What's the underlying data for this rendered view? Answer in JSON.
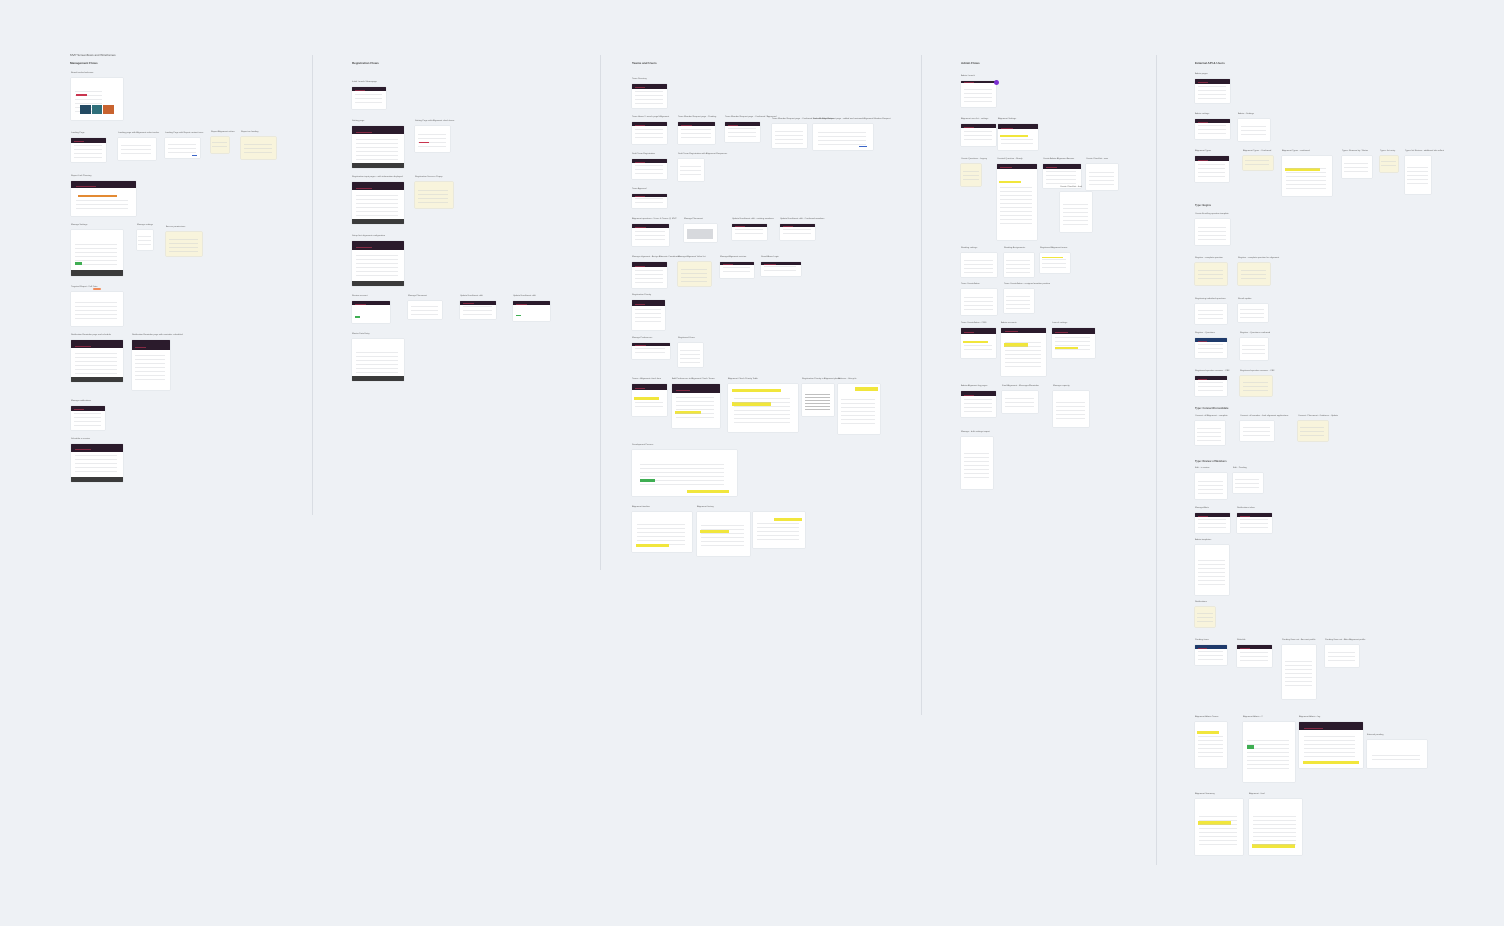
{
  "page": {
    "title": "MVP Screenflows and Wireframes"
  },
  "columns": [
    {
      "title": "Management Flows",
      "sections": [],
      "cards": [
        {
          "label": "Brand tracker/welcome",
          "style": "light",
          "variant": "tiles"
        },
        {
          "label": "Landing Page",
          "style": "light",
          "variant": "header"
        },
        {
          "label": "Landing page with Alignment value tracker",
          "style": "light",
          "variant": "lines"
        },
        {
          "label": "Landing Page with Report context trace",
          "style": "light",
          "variant": "lines"
        },
        {
          "label": "Report Alignment values",
          "style": "cream",
          "variant": "lines"
        },
        {
          "label": "Report on funding",
          "style": "cream",
          "variant": "lines"
        },
        {
          "label": "Report Link Planning",
          "style": "light",
          "variant": "header-red"
        },
        {
          "label": "Manage Settings",
          "style": "light",
          "variant": "header-footer"
        },
        {
          "label": "Manage settings",
          "style": "light",
          "variant": "lines"
        },
        {
          "label": "Access permissions",
          "style": "cream",
          "variant": "lines"
        },
        {
          "label": "Targeted Report - Full Data",
          "style": "light",
          "variant": "lines"
        },
        {
          "label": "Notification Reminder page and schedule",
          "style": "light",
          "variant": "header-footer"
        },
        {
          "label": "Notification Reminder page with reminder scheduled",
          "style": "light",
          "variant": "lines"
        },
        {
          "label": "Manage notifications",
          "style": "light",
          "variant": "header"
        },
        {
          "label": "Schedule a session",
          "style": "light",
          "variant": "header-footer"
        }
      ]
    },
    {
      "title": "Registration Flows",
      "sections": [],
      "cards": [
        {
          "label": "Initial Launch/ Homepage",
          "style": "light",
          "variant": "header"
        },
        {
          "label": "Setting page",
          "style": "light",
          "variant": "header-footer"
        },
        {
          "label": "Setting Page with Alignment check items",
          "style": "light",
          "variant": "lines"
        },
        {
          "label": "Registration input pages - with information displayed",
          "style": "light",
          "variant": "header-footer"
        },
        {
          "label": "Registration Success Popup",
          "style": "cream",
          "variant": "lines"
        },
        {
          "label": "Setup first alignment configuration",
          "style": "light",
          "variant": "header-footer"
        },
        {
          "label": "Review account",
          "style": "light",
          "variant": "header"
        },
        {
          "label": "Manage Placement",
          "style": "light",
          "variant": "lines"
        },
        {
          "label": "Update Enrollment shift",
          "style": "light",
          "variant": "header"
        },
        {
          "label": "Update Enrollment shift",
          "style": "light",
          "variant": "header"
        },
        {
          "label": "Master Data Entry",
          "style": "light",
          "variant": "header-footer"
        }
      ]
    },
    {
      "title": "Teams and Users",
      "sections": [],
      "cards": [
        {
          "label": "Team Directory",
          "style": "light",
          "variant": "header"
        },
        {
          "label": "Team Home / Launch page/ Alignment",
          "style": "light",
          "variant": "header"
        },
        {
          "label": "Team Member Request page - Pending",
          "style": "light",
          "variant": "header"
        },
        {
          "label": "Team Member Request page - Confirmed / Approved",
          "style": "light",
          "variant": "header"
        },
        {
          "label": "Team Member Request page - Confirmed and user Registration",
          "style": "light",
          "variant": "lines"
        },
        {
          "label": "Team Member Request page - added and reviewed Alignment Member Request",
          "style": "light",
          "variant": "lines"
        },
        {
          "label": "Draft Team Registration",
          "style": "light",
          "variant": "header"
        },
        {
          "label": "Draft Team Registration with Alignment Responses",
          "style": "light",
          "variant": "lines"
        },
        {
          "label": "Team Approval",
          "style": "light",
          "variant": "header"
        },
        {
          "label": "Alignment questions - Users & Teams @ MVP",
          "style": "light",
          "variant": "header"
        },
        {
          "label": "Manage Placement",
          "style": "light",
          "variant": "lines"
        },
        {
          "label": "Update Enrollment shift - existing members",
          "style": "light",
          "variant": "header"
        },
        {
          "label": "Update Enrollment shift - Confirmed members",
          "style": "light",
          "variant": "header"
        },
        {
          "label": "Manage alignment - Assign Alternate Coordinator",
          "style": "light",
          "variant": "header"
        },
        {
          "label": "Manage Alignment Value list",
          "style": "light",
          "variant": "lines"
        },
        {
          "label": "Manage Alignment revision",
          "style": "light",
          "variant": "header"
        },
        {
          "label": "Stand Alone Login",
          "style": "light",
          "variant": "header"
        },
        {
          "label": "Registration Priority",
          "style": "light",
          "variant": "lines"
        },
        {
          "label": "Manage Preferences",
          "style": "light",
          "variant": "header"
        },
        {
          "label": "Registered Users",
          "style": "light",
          "variant": "lines"
        },
        {
          "label": "Teams - Alignment check lane",
          "style": "light",
          "variant": "highlight"
        },
        {
          "label": "Add Preferences to Alignment Check Teams",
          "style": "light",
          "variant": "highlight"
        },
        {
          "label": "Alignment Check Priority Table",
          "style": "light",
          "variant": "lines"
        },
        {
          "label": "Registration Priority in Alignment phase",
          "style": "light",
          "variant": "highlight"
        },
        {
          "label": "Release - Lifecycle",
          "style": "light",
          "variant": "lines"
        },
        {
          "label": "Development Process",
          "style": "light",
          "variant": "highlight"
        },
        {
          "label": "Alignment timeline",
          "style": "light",
          "variant": "highlight"
        },
        {
          "label": "Alignment history",
          "style": "light",
          "variant": "highlight"
        }
      ]
    },
    {
      "title": "Admin Flows",
      "sections": [],
      "cards": [
        {
          "label": "Admin Launch",
          "style": "light",
          "variant": "lines"
        },
        {
          "label": "Alignment user list - settings",
          "style": "light",
          "variant": "header"
        },
        {
          "label": "Alignment Settings",
          "style": "light",
          "variant": "highlight"
        },
        {
          "label": "Create Questions - Legacy",
          "style": "cream",
          "variant": "lines"
        },
        {
          "label": "Created Question - Ready",
          "style": "light",
          "variant": "header"
        },
        {
          "label": "Create Admin Alignment Answer",
          "style": "light",
          "variant": "lines"
        },
        {
          "label": "Create Checklist - new",
          "style": "light",
          "variant": "lines"
        },
        {
          "label": "Create Checklist - final",
          "style": "light",
          "variant": "lines"
        },
        {
          "label": "Reading settings",
          "style": "light",
          "variant": "lines"
        },
        {
          "label": "Reading Assignments",
          "style": "light",
          "variant": "lines"
        },
        {
          "label": "Registered Alignment teams",
          "style": "light",
          "variant": "highlight"
        },
        {
          "label": "Team Constellation",
          "style": "light",
          "variant": "header"
        },
        {
          "label": "Team Constellation - assigned member position",
          "style": "light",
          "variant": "lines"
        },
        {
          "label": "Team Constellation - CMS",
          "style": "light",
          "variant": "lines"
        },
        {
          "label": "Admin accounts",
          "style": "light",
          "variant": "lines"
        },
        {
          "label": "Launch settings",
          "style": "light",
          "variant": "cream"
        },
        {
          "label": "Admin Alignment log pages",
          "style": "light",
          "variant": "header"
        },
        {
          "label": "Final Alignment - Messages/Reminder",
          "style": "light",
          "variant": "header-footer"
        },
        {
          "label": "Manage capacity",
          "style": "light",
          "variant": "header"
        },
        {
          "label": "Manage - bulk settings import",
          "style": "light",
          "variant": "cream"
        }
      ]
    },
    {
      "title": "External API & Users",
      "sections": [
        "Type: Begins",
        "Type: Connect/Consolidate",
        "Type: Review of Members"
      ],
      "cards": [
        {
          "label": "Admin pages",
          "style": "light",
          "variant": "header"
        },
        {
          "label": "Admin settings",
          "style": "light",
          "variant": "header"
        },
        {
          "label": "Admin - Settings",
          "style": "light",
          "variant": "lines"
        },
        {
          "label": "Alignment Types",
          "style": "light",
          "variant": "header"
        },
        {
          "label": "Alignment Types - Confirmed",
          "style": "cream",
          "variant": "lines"
        },
        {
          "label": "Alignment Types - confirmed",
          "style": "light",
          "variant": "highlight"
        },
        {
          "label": "Types: Remove by / Status",
          "style": "light",
          "variant": "lines"
        },
        {
          "label": "Types: list entry",
          "style": "cream",
          "variant": "lines"
        },
        {
          "label": "Types list Review - additional info rollout",
          "style": "light",
          "variant": "lines"
        },
        {
          "label": "Create Enrolling question template",
          "style": "light",
          "variant": "lines"
        },
        {
          "label": "Register - complete question",
          "style": "cream",
          "variant": "lines"
        },
        {
          "label": "Register - complete question for alignment",
          "style": "cream",
          "variant": "lines"
        },
        {
          "label": "Registering individual questions",
          "style": "light",
          "variant": "lines"
        },
        {
          "label": "Result update",
          "style": "light",
          "variant": "lines"
        },
        {
          "label": "Register - Questions",
          "style": "light",
          "variant": "header"
        },
        {
          "label": "Register - Questions confirmed",
          "style": "light",
          "variant": "lines"
        },
        {
          "label": "Registered question answers - CBF",
          "style": "light",
          "variant": "header"
        },
        {
          "label": "Registered question answers - CBF",
          "style": "cream",
          "variant": "lines"
        },
        {
          "label": "Connect: all Alignment - complete",
          "style": "light",
          "variant": "lines"
        },
        {
          "label": "Connect: all member - final alignment applications",
          "style": "light",
          "variant": "lines"
        },
        {
          "label": "Connect: Placement - Guidance - Update",
          "style": "cream",
          "variant": "lines"
        },
        {
          "label": "Edit - in review",
          "style": "light",
          "variant": "lines"
        },
        {
          "label": "Edit - Pending",
          "style": "light",
          "variant": "lines"
        },
        {
          "label": "Manage Alerts",
          "style": "light",
          "variant": "header"
        },
        {
          "label": "Notifications inbox",
          "style": "light",
          "variant": "header"
        },
        {
          "label": "Admin templates",
          "style": "light",
          "variant": "lines"
        },
        {
          "label": "Notifications",
          "style": "cream",
          "variant": "lines"
        },
        {
          "label": "Pending items",
          "style": "light",
          "variant": "header"
        },
        {
          "label": "Rebuilds",
          "style": "light",
          "variant": "header"
        },
        {
          "label": "Pending flows set - Account profile",
          "style": "light",
          "variant": "lines"
        },
        {
          "label": "Pending flows set - After Alignment profile",
          "style": "light",
          "variant": "lines"
        },
        {
          "label": "Alignment Admin Teams",
          "style": "light",
          "variant": "highlight"
        },
        {
          "label": "Alignment Admin - 2",
          "style": "light",
          "variant": "lines"
        },
        {
          "label": "Alignment Admin - log",
          "style": "light",
          "variant": "header"
        },
        {
          "label": "External pending",
          "style": "light",
          "variant": "lines"
        },
        {
          "label": "Alignment Summary",
          "style": "light",
          "variant": "highlight"
        },
        {
          "label": "Alignment - final",
          "style": "light",
          "variant": "highlight"
        }
      ]
    }
  ]
}
